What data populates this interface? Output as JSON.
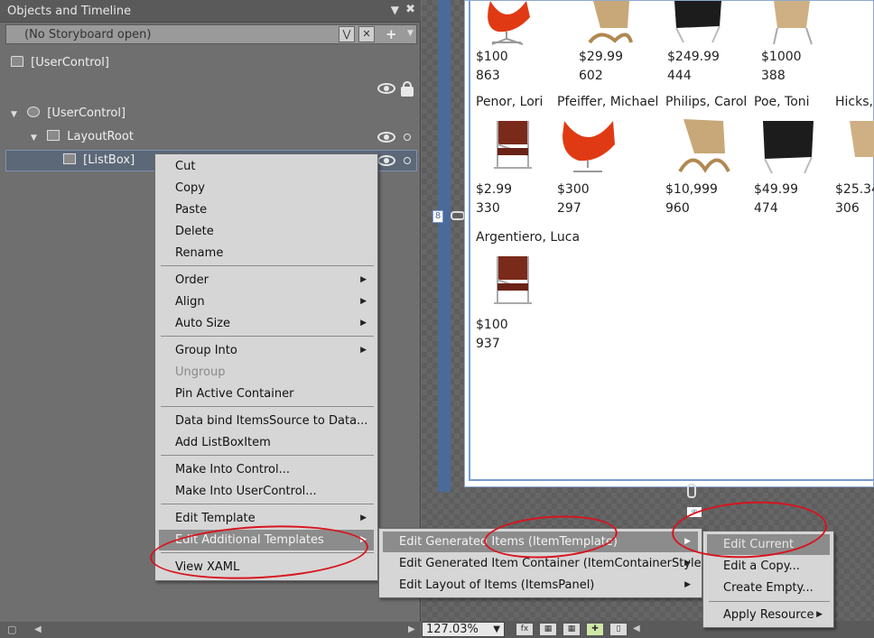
{
  "panel": {
    "title": "Objects and Timeline",
    "storyboard_label": "(No Storyboard open)",
    "root_label": "[UserControl]",
    "tree": [
      {
        "label": "[UserControl]"
      },
      {
        "label": "LayoutRoot"
      },
      {
        "label": "[ListBox]"
      }
    ]
  },
  "artboard": {
    "items": [
      {
        "name": "",
        "price": "$100",
        "qty": "863"
      },
      {
        "name": "",
        "price": "$29.99",
        "qty": "602"
      },
      {
        "name": "",
        "price": "$249.99",
        "qty": "444"
      },
      {
        "name": "",
        "price": "$1000",
        "qty": "388"
      },
      {
        "name": "Penor, Lori",
        "price": "$2.99",
        "qty": "330"
      },
      {
        "name": "Pfeiffer, Michael",
        "price": "$300",
        "qty": "297"
      },
      {
        "name": "Philips, Carol",
        "price": "$10,999",
        "qty": "960"
      },
      {
        "name": "Poe, Toni",
        "price": "$49.99",
        "qty": "474"
      },
      {
        "name": "Hicks,",
        "price": "$25.34",
        "qty": "306"
      },
      {
        "name": "Argentiero, Luca",
        "price": "$100",
        "qty": "937"
      }
    ],
    "ruler_marker": "8",
    "zoom": "127.03%"
  },
  "context_menu": {
    "items": [
      "Cut",
      "Copy",
      "Paste",
      "Delete",
      "Rename",
      "Order",
      "Align",
      "Auto Size",
      "Group Into",
      "Ungroup",
      "Pin Active Container",
      "Data bind ItemsSource to Data...",
      "Add ListBoxItem",
      "Make Into Control...",
      "Make Into UserControl...",
      "Edit Template",
      "Edit Additional Templates",
      "View XAML"
    ]
  },
  "submenu_templates": {
    "items": [
      "Edit Generated Items (ItemTemplate)",
      "Edit Generated Item Container (ItemContainerStyle)",
      "Edit Layout of Items (ItemsPanel)"
    ]
  },
  "submenu_item_template": {
    "items": [
      "Edit Current",
      "Edit a Copy...",
      "Create Empty...",
      "Apply Resource"
    ]
  },
  "colors": {
    "annotation_red": "#d8141e",
    "highlight": "#8c8c8c",
    "chair_red": "#e03a14"
  }
}
